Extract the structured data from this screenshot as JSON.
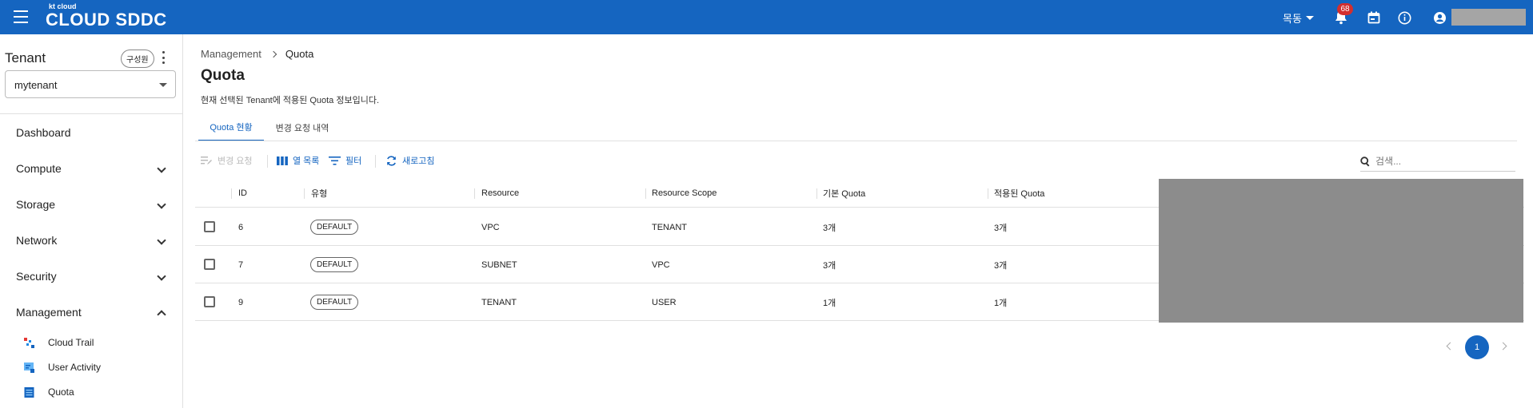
{
  "header": {
    "logo_small": "kt cloud",
    "logo_big": "CLOUD SDDC",
    "language": "목동",
    "notification_count": "68"
  },
  "sidebar": {
    "tenant_title": "Tenant",
    "members_label": "구성원",
    "tenant_selected": "mytenant",
    "nav": [
      {
        "label": "Dashboard"
      },
      {
        "label": "Compute"
      },
      {
        "label": "Storage"
      },
      {
        "label": "Network"
      },
      {
        "label": "Security"
      },
      {
        "label": "Management"
      }
    ],
    "management_items": [
      {
        "label": "Cloud Trail",
        "icon": "cloud-trail-icon"
      },
      {
        "label": "User Activity",
        "icon": "user-activity-icon"
      },
      {
        "label": "Quota",
        "icon": "quota-icon"
      }
    ]
  },
  "breadcrumb": {
    "parent": "Management",
    "current": "Quota"
  },
  "page": {
    "title": "Quota",
    "description": "현재 선택된 Tenant에 적용된 Quota 정보입니다."
  },
  "tabs": [
    {
      "label": "Quota 현황",
      "active": true
    },
    {
      "label": "변경 요청 내역",
      "active": false
    }
  ],
  "toolbar": {
    "change_request": "변경 요청",
    "columns": "열 목록",
    "filter": "필터",
    "refresh": "새로고침",
    "search_placeholder": "검색..."
  },
  "table": {
    "columns": [
      "ID",
      "유형",
      "Resource",
      "Resource Scope",
      "기본 Quota",
      "적용된 Quota"
    ],
    "rows": [
      {
        "id": "6",
        "type": "DEFAULT",
        "resource": "VPC",
        "scope": "TENANT",
        "base_quota": "3개",
        "applied_quota": "3개"
      },
      {
        "id": "7",
        "type": "DEFAULT",
        "resource": "SUBNET",
        "scope": "VPC",
        "base_quota": "3개",
        "applied_quota": "3개"
      },
      {
        "id": "9",
        "type": "DEFAULT",
        "resource": "TENANT",
        "scope": "USER",
        "base_quota": "1개",
        "applied_quota": "1개"
      }
    ]
  },
  "pagination": {
    "current_page": "1"
  },
  "colors": {
    "primary": "#1565c0",
    "badge": "#d32f2f"
  }
}
